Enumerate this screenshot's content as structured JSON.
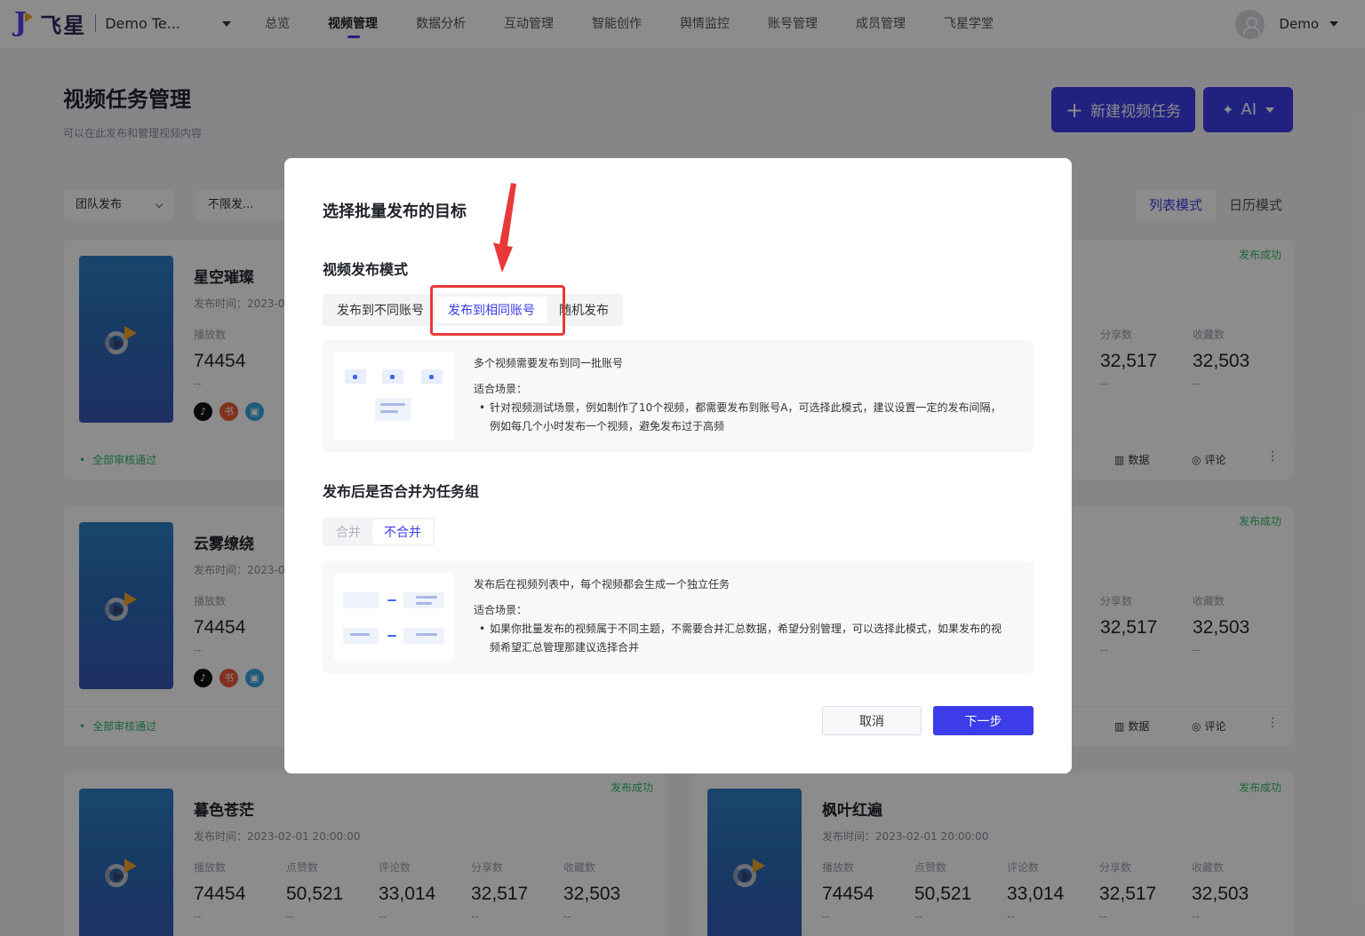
{
  "app": {
    "logo_text": "飞星",
    "team_name": "Demo Te...",
    "nav": [
      "总览",
      "视频管理",
      "数据分析",
      "互动管理",
      "智能创作",
      "舆情监控",
      "账号管理",
      "成员管理",
      "飞星学堂"
    ],
    "active_nav": "视频管理",
    "user_name": "Demo"
  },
  "page": {
    "title": "视频任务管理",
    "subtitle": "可以在此发布和管理视频内容",
    "new_task_label": "新建视频任务",
    "ai_label": "AI"
  },
  "filters": {
    "team_publish": "团队发布",
    "publish_range": "不限发..."
  },
  "view_modes": {
    "list": "列表模式",
    "calendar": "日历模式",
    "active": "列表模式"
  },
  "metric_labels": {
    "plays": "播放数",
    "likes": "点赞数",
    "comments": "评论数",
    "shares": "分享数",
    "favorites": "收藏数"
  },
  "cards": [
    {
      "title": "星空璀璨",
      "time": "发布时间：2023-0",
      "status": "发布成功",
      "plays": "74454",
      "shares": "32,517",
      "favorites": "32,503",
      "approval": "全部审核通过",
      "action_data": "数据",
      "action_comment": "评论",
      "sub": "--"
    },
    {
      "title": "云雾缭绕",
      "time": "发布时间：2023-0",
      "status": "发布成功",
      "plays": "74454",
      "shares": "32,517",
      "favorites": "32,503",
      "approval": "全部审核通过",
      "action_data": "数据",
      "action_comment": "评论",
      "sub": "--"
    },
    {
      "title": "暮色苍茫",
      "time": "发布时间：2023-02-01 20:00:00",
      "status": "发布成功",
      "plays": "74454",
      "likes": "50,521",
      "comments": "33,014",
      "shares": "32,517",
      "favorites": "32,503",
      "sub": "--"
    },
    {
      "title": "枫叶红遍",
      "time": "发布时间：2023-02-01 20:00:00",
      "status": "发布成功",
      "plays": "74454",
      "likes": "50,521",
      "comments": "33,014",
      "shares": "32,517",
      "favorites": "32,503",
      "sub": "--"
    }
  ],
  "modal": {
    "title": "选择批量发布的目标",
    "mode_section": "视频发布模式",
    "modes": [
      "发布到不同账号",
      "发布到相同账号",
      "随机发布"
    ],
    "active_mode": "发布到相同账号",
    "mode_desc": {
      "headline": "多个视频需要发布到同一批账号",
      "scene_label": "适合场景：",
      "bullet": "针对视频测试场景，例如制作了10个视频，都需要发布到账号A，可选择此模式，建议设置一定的发布间隔，例如每几个小时发布一个视频，避免发布过于高频"
    },
    "merge_section": "发布后是否合并为任务组",
    "merge_options": [
      "合并",
      "不合并"
    ],
    "active_merge": "不合并",
    "merge_desc": {
      "headline": "发布后在视频列表中，每个视频都会生成一个独立任务",
      "scene_label": "适合场景：",
      "bullet": "如果你批量发布的视频属于不同主题，不需要合并汇总数据，希望分别管理，可以选择此模式，如果发布的视频希望汇总管理那建议选择合并"
    },
    "cancel_label": "取消",
    "next_label": "下一步"
  },
  "colors": {
    "primary": "#3c3ce8",
    "success": "#2fb86a",
    "annotation": "#e8393a"
  }
}
